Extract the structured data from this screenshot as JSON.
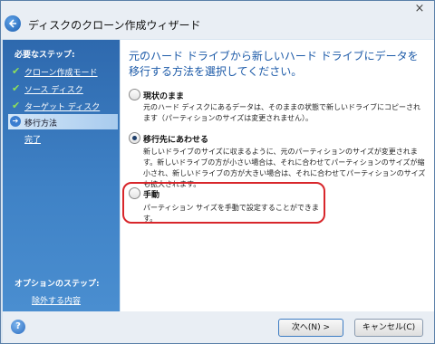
{
  "window": {
    "title": "ディスクのクローン作成ウィザード",
    "close_glyph": "×"
  },
  "sidebar": {
    "required_heading": "必要なステップ:",
    "steps": [
      {
        "label": "クローン作成モード",
        "state": "done"
      },
      {
        "label": "ソース ディスク",
        "state": "done"
      },
      {
        "label": "ターゲット ディスク",
        "state": "done"
      },
      {
        "label": "移行方法",
        "state": "current"
      },
      {
        "label": "完了",
        "state": "pending"
      }
    ],
    "optional_heading": "オプションのステップ:",
    "optional_link": "除外する内容"
  },
  "main": {
    "heading": "元のハード ドライブから新しいハード ドライブにデータを移行する方法を選択してください。",
    "options": [
      {
        "label": "現状のまま",
        "description": "元のハード ディスクにあるデータは、そのままの状態で新しいドライブにコピーされます（パーティションのサイズは変更されません）。",
        "selected": false
      },
      {
        "label": "移行先にあわせる",
        "description": "新しいドライブのサイズに収まるように、元のパーティションのサイズが変更されます。新しいドライブの方が小さい場合は、それに合わせてパーティションのサイズが縮小され、新しいドライブの方が大きい場合は、それに合わせてパーティションのサイズも拡大されます。",
        "selected": true
      },
      {
        "label": "手動",
        "description": "パーティション サイズを手動で設定することができます。",
        "selected": false
      }
    ]
  },
  "footer": {
    "help_glyph": "?",
    "next_label": "次へ(N) >",
    "cancel_label": "キャンセル(C)"
  },
  "colors": {
    "heading_text": "#1c5aa8",
    "highlight_border": "#d8262b",
    "sidebar_top": "#2e69ae",
    "sidebar_bottom": "#4a8ed0"
  }
}
